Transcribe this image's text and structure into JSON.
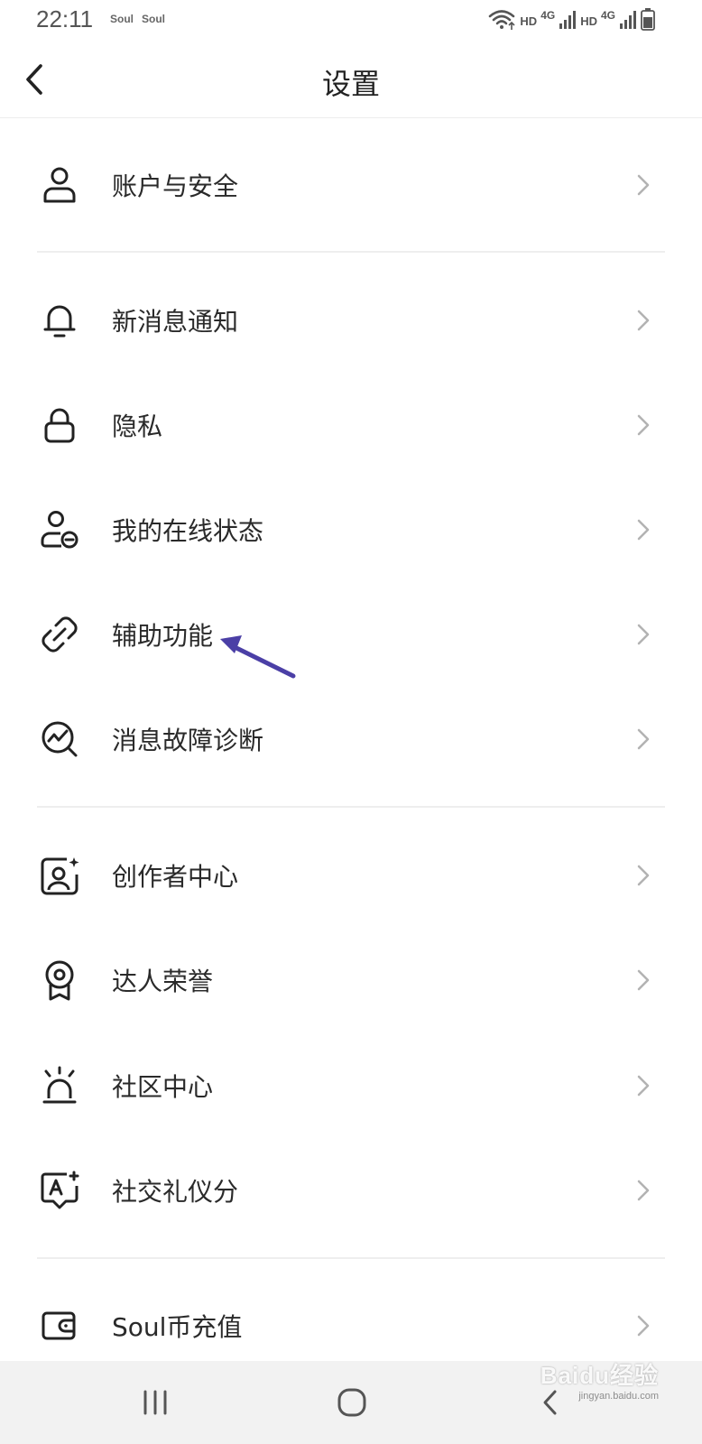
{
  "status_bar": {
    "time": "22:11",
    "app_badges": [
      "Soul",
      "Soul"
    ],
    "sim1": {
      "hd": "HD",
      "network": "4G"
    },
    "sim2": {
      "hd": "HD",
      "network": "4G"
    }
  },
  "header": {
    "title": "设置",
    "back_icon": "chevron-left-icon"
  },
  "menu": {
    "items": [
      {
        "label": "账户与安全",
        "icon": "user-icon"
      },
      {
        "label": "新消息通知",
        "icon": "bell-icon"
      },
      {
        "label": "隐私",
        "icon": "lock-icon"
      },
      {
        "label": "我的在线状态",
        "icon": "user-status-icon"
      },
      {
        "label": "辅助功能",
        "icon": "link-icon"
      },
      {
        "label": "消息故障诊断",
        "icon": "diagnosis-icon"
      },
      {
        "label": "创作者中心",
        "icon": "creator-icon"
      },
      {
        "label": "达人荣誉",
        "icon": "medal-icon"
      },
      {
        "label": "社区中心",
        "icon": "alarm-icon"
      },
      {
        "label": "社交礼仪分",
        "icon": "etiquette-icon"
      },
      {
        "label": "Soul币充值",
        "icon": "wallet-icon"
      }
    ]
  },
  "annotation": {
    "color": "#4b3fa6",
    "points_to": "辅助功能"
  },
  "system_nav": {
    "recents_icon": "recents-icon",
    "home_icon": "home-icon",
    "back_icon": "back-icon"
  },
  "watermark": {
    "brand": "Baidu经验",
    "url": "jingyan.baidu.com"
  }
}
